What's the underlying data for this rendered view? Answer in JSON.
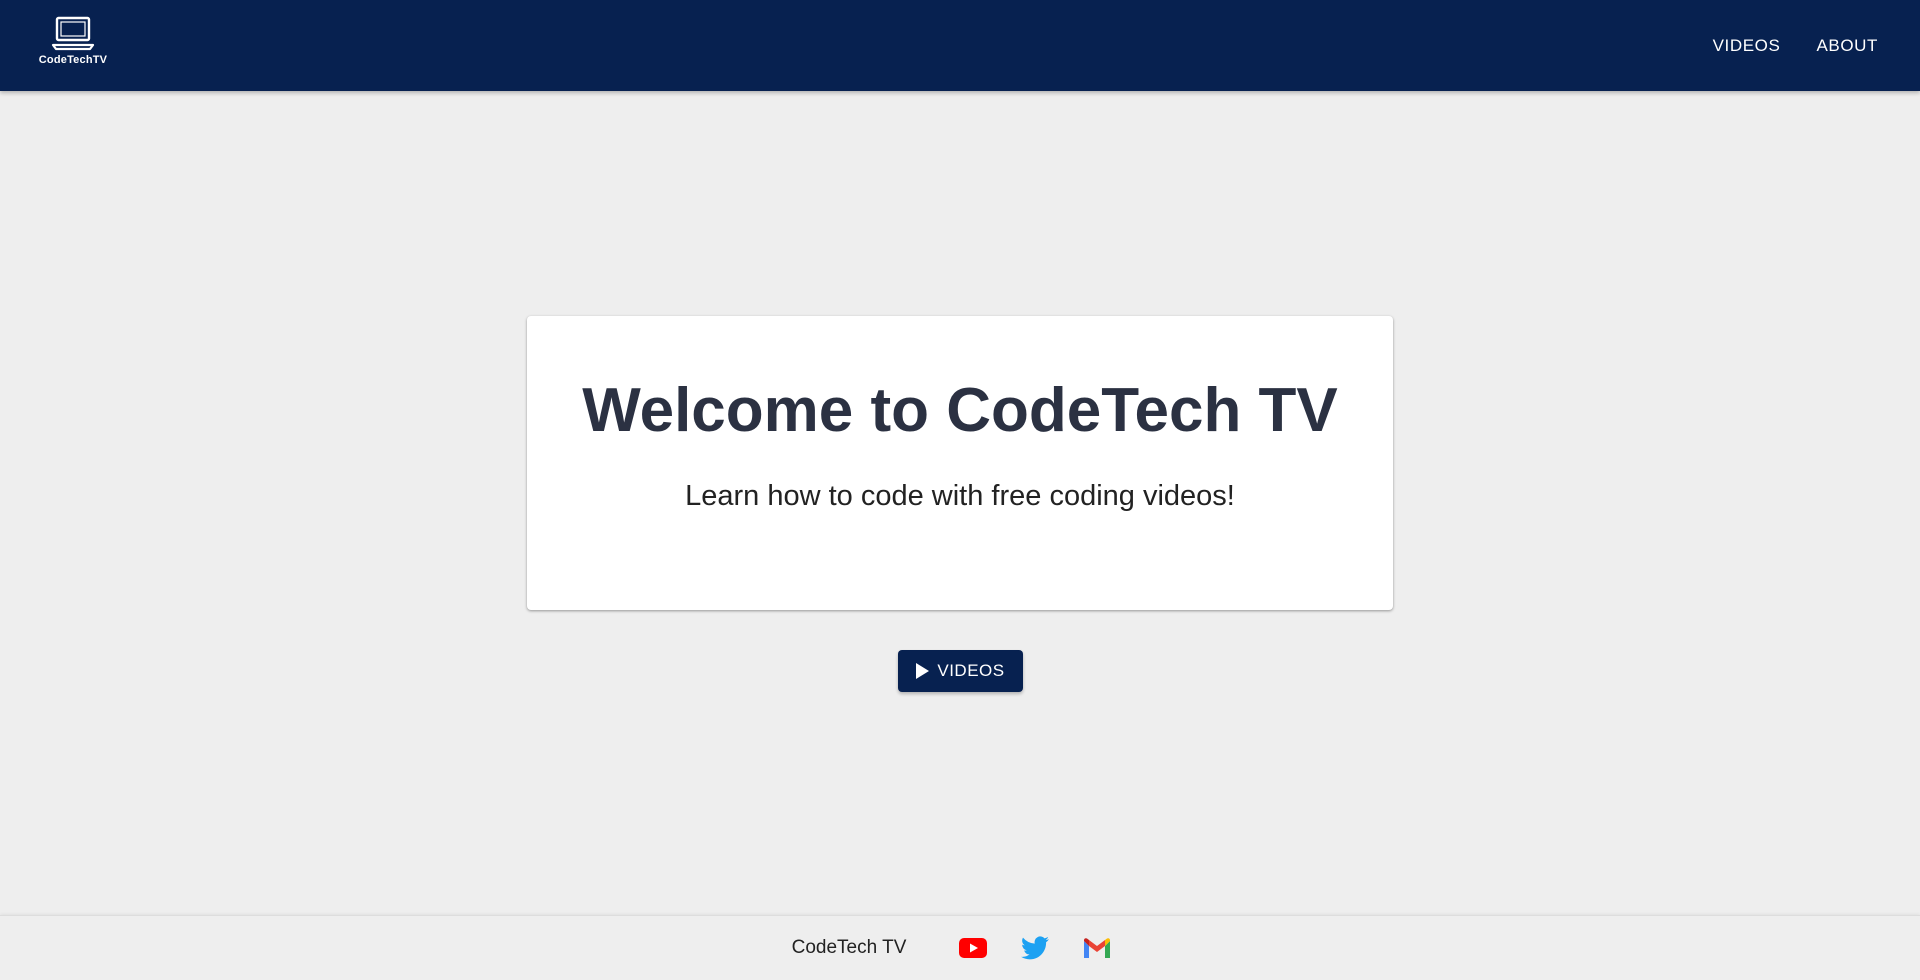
{
  "header": {
    "logo_text": "CodeTechTV",
    "nav": [
      {
        "label": "VIDEOS"
      },
      {
        "label": "ABOUT"
      }
    ],
    "background_color": "#072150"
  },
  "hero": {
    "title": "Welcome to CodeTech TV",
    "subtitle": "Learn how to code with free coding videos!"
  },
  "cta": {
    "label": "VIDEOS",
    "icon": "play-icon"
  },
  "footer": {
    "brand": "CodeTech TV",
    "links": [
      {
        "icon": "youtube-icon",
        "color": "#ff0000"
      },
      {
        "icon": "twitter-icon",
        "color": "#1da1f2"
      },
      {
        "icon": "gmail-icon",
        "color": "#ea4335"
      }
    ]
  }
}
